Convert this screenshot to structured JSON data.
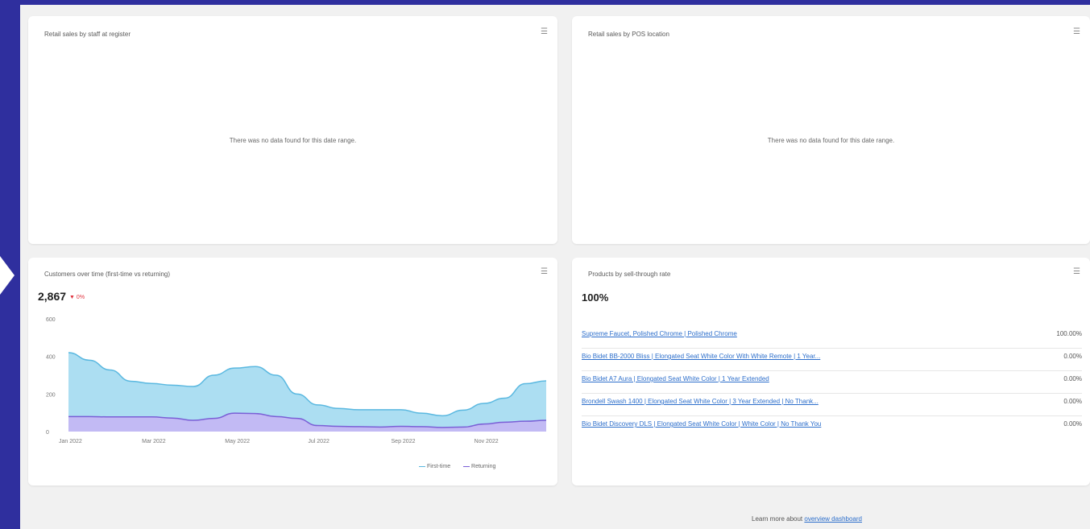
{
  "cards": {
    "staff": {
      "title": "Retail sales by staff at register",
      "empty_message": "There was no data found for this date range."
    },
    "pos": {
      "title": "Retail sales by POS location",
      "empty_message": "There was no data found for this date range."
    },
    "customers": {
      "title": "Customers over time (first-time vs returning)",
      "metric": "2,867",
      "delta": "▼ 0%",
      "legend": [
        "First-time",
        "Returning"
      ]
    },
    "sellthrough": {
      "title": "Products by sell-through rate",
      "metric": "100%",
      "rows": [
        {
          "name": "Supreme Faucet, Polished Chrome | Polished Chrome",
          "value": "100.00%"
        },
        {
          "name": "Bio Bidet BB-2000 Bliss | Elongated Seat White Color With White Remote | 1 Year...",
          "value": "0.00%"
        },
        {
          "name": "Bio Bidet A7 Aura | Elongated Seat White Color | 1 Year Extended",
          "value": "0.00%"
        },
        {
          "name": "Brondell Swash 1400 | Elongated Seat White Color | 3 Year Extended | No Thank...",
          "value": "0.00%"
        },
        {
          "name": "Bio Bidet Discovery DLS | Elongated Seat White Color | White Color | No Thank You",
          "value": "0.00%"
        }
      ]
    }
  },
  "footer": {
    "text": "Learn more about",
    "link": "overview dashboard"
  },
  "chart_data": {
    "type": "area",
    "title": "Customers over time (first-time vs returning)",
    "x": [
      "Jan 2022",
      "",
      "",
      "",
      "Mar 2022",
      "",
      "",
      "",
      "May 2022",
      "",
      "",
      "",
      "Jul 2022",
      "",
      "",
      "",
      "Sep 2022",
      "",
      "",
      "",
      "Nov 2022",
      "",
      "",
      ""
    ],
    "xtick_labels": [
      "Jan 2022",
      "Mar 2022",
      "May 2022",
      "Jul 2022",
      "Sep 2022",
      "Nov 2022"
    ],
    "ytick_labels": [
      "0",
      "200",
      "400",
      "600"
    ],
    "ylim": [
      0,
      600
    ],
    "series": [
      {
        "name": "Returning",
        "color": "#a89cf0",
        "values": [
          80,
          80,
          78,
          78,
          78,
          72,
          60,
          70,
          98,
          96,
          80,
          70,
          32,
          28,
          26,
          24,
          28,
          26,
          22,
          24,
          40,
          50,
          55,
          60
        ]
      },
      {
        "name": "First-time",
        "color": "#9ed8f0",
        "values": [
          340,
          300,
          250,
          190,
          178,
          175,
          180,
          230,
          240,
          250,
          220,
          130,
          110,
          95,
          90,
          92,
          88,
          72,
          62,
          90,
          110,
          128,
          200,
          210
        ]
      }
    ],
    "colors": {
      "first_time_line": "#5ab8e0",
      "returning_line": "#7a5fd6"
    },
    "legend_position": "bottom-right",
    "grid": false
  }
}
